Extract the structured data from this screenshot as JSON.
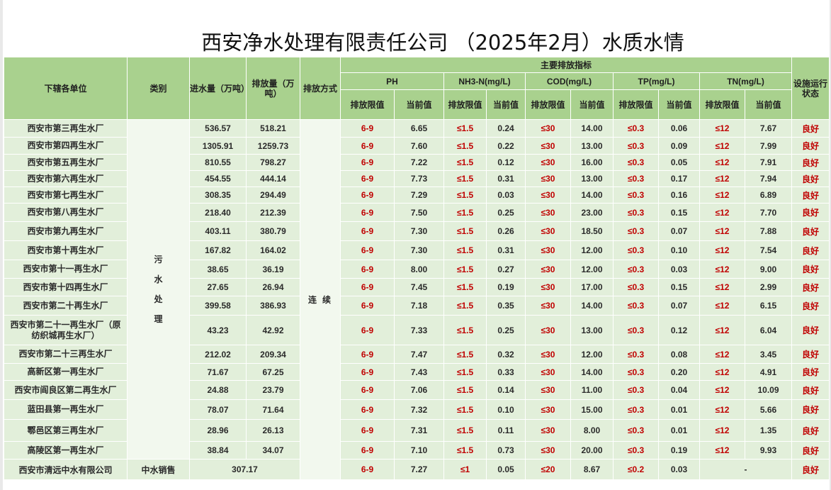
{
  "title": "西安净水处理有限责任公司 （2025年2月）水质水情",
  "headers": {
    "unit": "下辖各单位",
    "category": "类别",
    "inflow": "进水量（万吨）",
    "discharge": "排放量（万吨）",
    "method": "排放方式",
    "indicators": "主要排放指标",
    "ph": "PH",
    "nh3": "NH3-N(mg/L)",
    "cod": "COD(mg/L)",
    "tp": "TP(mg/L)",
    "tn": "TN(mg/L)",
    "limit": "排放限值",
    "current": "当前值",
    "status": "设施运行状态"
  },
  "category_sewage": "污水处理",
  "method_continuous": "连续",
  "rows": [
    {
      "unit": "西安市第三再生水厂",
      "inflow": "536.57",
      "discharge": "518.21",
      "ph_limit": "6-9",
      "ph": "6.65",
      "nh3_limit": "≤1.5",
      "nh3": "0.24",
      "cod_limit": "≤30",
      "cod": "14.00",
      "tp_limit": "≤0.3",
      "tp": "0.06",
      "tn_limit": "≤12",
      "tn": "7.67",
      "status": "良好"
    },
    {
      "unit": "西安市第四再生水厂",
      "inflow": "1305.91",
      "discharge": "1259.73",
      "ph_limit": "6-9",
      "ph": "7.60",
      "nh3_limit": "≤1.5",
      "nh3": "0.22",
      "cod_limit": "≤30",
      "cod": "13.00",
      "tp_limit": "≤0.3",
      "tp": "0.09",
      "tn_limit": "≤12",
      "tn": "7.99",
      "status": "良好"
    },
    {
      "unit": "西安市第五再生水厂",
      "inflow": "810.55",
      "discharge": "798.27",
      "ph_limit": "6-9",
      "ph": "7.22",
      "nh3_limit": "≤1.5",
      "nh3": "0.12",
      "cod_limit": "≤30",
      "cod": "16.00",
      "tp_limit": "≤0.3",
      "tp": "0.05",
      "tn_limit": "≤12",
      "tn": "7.91",
      "status": "良好"
    },
    {
      "unit": "西安市第六再生水厂",
      "inflow": "454.55",
      "discharge": "444.14",
      "ph_limit": "6-9",
      "ph": "7.73",
      "nh3_limit": "≤1.5",
      "nh3": "0.31",
      "cod_limit": "≤30",
      "cod": "13.00",
      "tp_limit": "≤0.3",
      "tp": "0.17",
      "tn_limit": "≤12",
      "tn": "7.94",
      "status": "良好"
    },
    {
      "unit": "西安市第七再生水厂",
      "inflow": "308.35",
      "discharge": "294.49",
      "ph_limit": "6-9",
      "ph": "7.29",
      "nh3_limit": "≤1.5",
      "nh3": "0.03",
      "cod_limit": "≤30",
      "cod": "14.00",
      "tp_limit": "≤0.3",
      "tp": "0.16",
      "tn_limit": "≤12",
      "tn": "6.89",
      "status": "良好"
    },
    {
      "unit": "西安市第八再生水厂",
      "inflow": "218.40",
      "discharge": "212.39",
      "ph_limit": "6-9",
      "ph": "7.50",
      "nh3_limit": "≤1.5",
      "nh3": "0.25",
      "cod_limit": "≤30",
      "cod": "23.00",
      "tp_limit": "≤0.3",
      "tp": "0.15",
      "tn_limit": "≤12",
      "tn": "7.70",
      "status": "良好"
    },
    {
      "unit": "西安市第九再生水厂",
      "inflow": "403.11",
      "discharge": "380.79",
      "ph_limit": "6-9",
      "ph": "7.30",
      "nh3_limit": "≤1.5",
      "nh3": "0.26",
      "cod_limit": "≤30",
      "cod": "18.50",
      "tp_limit": "≤0.3",
      "tp": "0.07",
      "tn_limit": "≤12",
      "tn": "7.88",
      "status": "良好"
    },
    {
      "unit": "西安市第十再生水厂",
      "inflow": "167.82",
      "discharge": "164.02",
      "ph_limit": "6-9",
      "ph": "7.30",
      "nh3_limit": "≤1.5",
      "nh3": "0.31",
      "cod_limit": "≤30",
      "cod": "12.00",
      "tp_limit": "≤0.3",
      "tp": "0.10",
      "tn_limit": "≤12",
      "tn": "7.54",
      "status": "良好"
    },
    {
      "unit": "西安市第十一再生水厂",
      "inflow": "38.65",
      "discharge": "36.19",
      "ph_limit": "6-9",
      "ph": "8.00",
      "nh3_limit": "≤1.5",
      "nh3": "0.27",
      "cod_limit": "≤30",
      "cod": "12.00",
      "tp_limit": "≤0.3",
      "tp": "0.03",
      "tn_limit": "≤12",
      "tn": "9.00",
      "status": "良好"
    },
    {
      "unit": "西安市第十四再生水厂",
      "inflow": "27.65",
      "discharge": "26.94",
      "ph_limit": "6-9",
      "ph": "7.45",
      "nh3_limit": "≤1.5",
      "nh3": "0.19",
      "cod_limit": "≤30",
      "cod": "17.00",
      "tp_limit": "≤0.3",
      "tp": "0.15",
      "tn_limit": "≤12",
      "tn": "2.99",
      "status": "良好"
    },
    {
      "unit": "西安市第二十再生水厂",
      "inflow": "399.58",
      "discharge": "386.93",
      "ph_limit": "6-9",
      "ph": "7.18",
      "nh3_limit": "≤1.5",
      "nh3": "0.35",
      "cod_limit": "≤30",
      "cod": "14.00",
      "tp_limit": "≤0.3",
      "tp": "0.07",
      "tn_limit": "≤12",
      "tn": "6.15",
      "status": "良好"
    },
    {
      "unit": "西安市第二十一再生水厂（原纺织城再生水厂）",
      "inflow": "43.23",
      "discharge": "42.92",
      "ph_limit": "6-9",
      "ph": "7.33",
      "nh3_limit": "≤1.5",
      "nh3": "0.25",
      "cod_limit": "≤30",
      "cod": "13.00",
      "tp_limit": "≤0.3",
      "tp": "0.12",
      "tn_limit": "≤12",
      "tn": "6.04",
      "status": "良好"
    },
    {
      "unit": "西安市第二十三再生水厂",
      "inflow": "212.02",
      "discharge": "209.34",
      "ph_limit": "6-9",
      "ph": "7.47",
      "nh3_limit": "≤1.5",
      "nh3": "0.32",
      "cod_limit": "≤30",
      "cod": "12.00",
      "tp_limit": "≤0.3",
      "tp": "0.08",
      "tn_limit": "≤12",
      "tn": "3.45",
      "status": "良好"
    },
    {
      "unit": "高新区第一再生水厂",
      "inflow": "71.67",
      "discharge": "67.25",
      "ph_limit": "6-9",
      "ph": "7.43",
      "nh3_limit": "≤1.5",
      "nh3": "0.33",
      "cod_limit": "≤30",
      "cod": "14.00",
      "tp_limit": "≤0.3",
      "tp": "0.20",
      "tn_limit": "≤12",
      "tn": "4.91",
      "status": "良好"
    },
    {
      "unit": "西安市阎良区第二再生水厂",
      "inflow": "24.88",
      "discharge": "23.79",
      "ph_limit": "6-9",
      "ph": "7.06",
      "nh3_limit": "≤1.5",
      "nh3": "0.14",
      "cod_limit": "≤30",
      "cod": "11.00",
      "tp_limit": "≤0.3",
      "tp": "0.04",
      "tn_limit": "≤12",
      "tn": "10.09",
      "status": "良好"
    },
    {
      "unit": "蓝田县第一再生水厂",
      "inflow": "78.07",
      "discharge": "71.64",
      "ph_limit": "6-9",
      "ph": "7.32",
      "nh3_limit": "≤1.5",
      "nh3": "0.10",
      "cod_limit": "≤30",
      "cod": "15.00",
      "tp_limit": "≤0.3",
      "tp": "0.01",
      "tn_limit": "≤12",
      "tn": "5.66",
      "status": "良好"
    },
    {
      "unit": "鄠邑区第三再生水厂",
      "inflow": "28.96",
      "discharge": "26.13",
      "ph_limit": "6-9",
      "ph": "7.31",
      "nh3_limit": "≤1.5",
      "nh3": "0.11",
      "cod_limit": "≤30",
      "cod": "8.00",
      "tp_limit": "≤0.3",
      "tp": "0.01",
      "tn_limit": "≤12",
      "tn": "1.35",
      "status": "良好"
    },
    {
      "unit": "高陵区第一再生水厂",
      "inflow": "38.84",
      "discharge": "34.07",
      "ph_limit": "6-9",
      "ph": "7.10",
      "nh3_limit": "≤1.5",
      "nh3": "0.73",
      "cod_limit": "≤30",
      "cod": "20.00",
      "tp_limit": "≤0.3",
      "tp": "0.19",
      "tn_limit": "≤12",
      "tn": "9.93",
      "status": "良好"
    }
  ],
  "last_row": {
    "unit": "西安市清远中水有限公司",
    "category": "中水销售",
    "volume": "307.17",
    "ph_limit": "6-9",
    "ph": "7.27",
    "nh3_limit": "≤1",
    "nh3": "0.05",
    "cod_limit": "≤20",
    "cod": "8.67",
    "tp_limit": "≤0.2",
    "tp": "0.03",
    "tn": "-",
    "status": "良好"
  }
}
